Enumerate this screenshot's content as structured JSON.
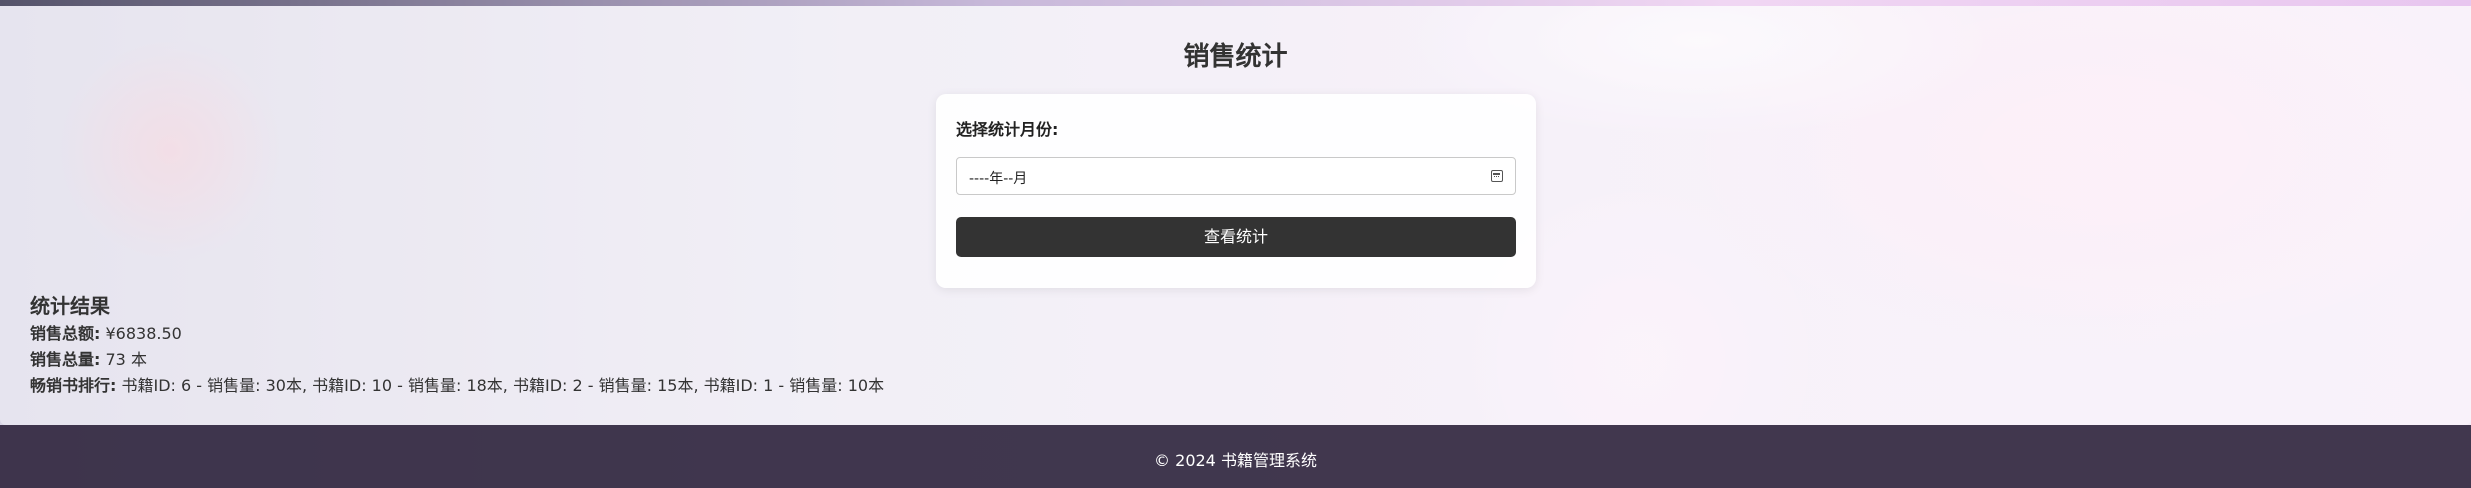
{
  "page": {
    "title": "销售统计"
  },
  "form": {
    "label": "选择统计月份:",
    "month_value": "----年--月",
    "submit_label": "查看统计"
  },
  "results": {
    "heading": "统计结果",
    "total_amount_label": "销售总额:",
    "total_amount_value": "¥6838.50",
    "total_qty_label": "销售总量:",
    "total_qty_value": "73 本",
    "bestseller_label": "畅销书排行:",
    "bestseller_value": "书籍ID: 6 - 销售量: 30本, 书籍ID: 10 - 销售量: 18本, 书籍ID: 2 - 销售量: 15本, 书籍ID: 1 - 销售量: 10本"
  },
  "footer": {
    "text": "© 2024 书籍管理系统"
  },
  "colors": {
    "button_bg": "#333333",
    "footer_bg": "#281e37"
  },
  "icons": {
    "month_picker": "calendar-icon"
  }
}
